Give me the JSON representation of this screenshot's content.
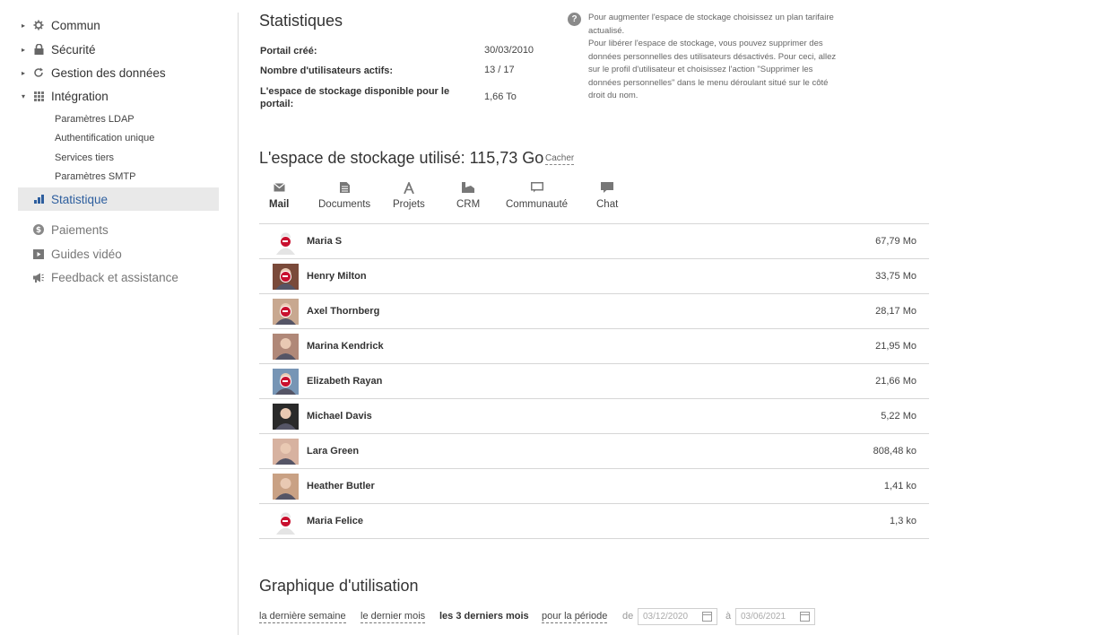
{
  "sidebar": {
    "items": [
      {
        "label": "Commun",
        "icon": "gear-icon",
        "arrow": "right"
      },
      {
        "label": "Sécurité",
        "icon": "lock-icon",
        "arrow": "right"
      },
      {
        "label": "Gestion des données",
        "icon": "refresh-icon",
        "arrow": "right"
      },
      {
        "label": "Intégration",
        "icon": "grid-icon",
        "arrow": "down"
      }
    ],
    "subitems": [
      "Paramètres LDAP",
      "Authentification unique",
      "Services tiers",
      "Paramètres SMTP"
    ],
    "active": {
      "label": "Statistique",
      "icon": "bar-chart-icon"
    },
    "bottom": [
      {
        "label": "Paiements",
        "icon": "dollar-icon"
      },
      {
        "label": "Guides vidéo",
        "icon": "video-icon"
      },
      {
        "label": "Feedback et assistance",
        "icon": "megaphone-icon"
      }
    ]
  },
  "stats": {
    "title": "Statistiques",
    "rows": [
      {
        "label": "Portail créé:",
        "value": "30/03/2010"
      },
      {
        "label": "Nombre d'utilisateurs actifs:",
        "value": "13 / 17"
      },
      {
        "label": "L'espace de stockage disponible pour le portail:",
        "value": "1,66 To"
      }
    ],
    "help_icon": "question-icon",
    "help_lines": [
      "Pour augmenter l'espace de stockage choisissez un plan tarifaire actualisé.",
      "Pour libérer l'espace de stockage, vous pouvez supprimer des données personnelles des utilisateurs désactivés. Pour ceci, allez sur le profil d'utilisateur et choisissez l'action \"Supprimer les données personnelles\" dans le menu déroulant situé sur le côté droit du nom."
    ]
  },
  "storage": {
    "title": "L'espace de stockage utilisé: 115,73 Go",
    "hide_label": "Cacher",
    "tabs": [
      {
        "label": "Mail",
        "icon": "mail-icon",
        "active": true
      },
      {
        "label": "Documents",
        "icon": "document-icon",
        "active": false
      },
      {
        "label": "Projets",
        "icon": "projects-icon",
        "active": false
      },
      {
        "label": "CRM",
        "icon": "crm-icon",
        "active": false
      },
      {
        "label": "Communauté",
        "icon": "community-icon",
        "active": false
      },
      {
        "label": "Chat",
        "icon": "chat-icon",
        "active": false
      }
    ],
    "users": [
      {
        "name": "Maria S",
        "size": "67,79 Mo",
        "blocked": true,
        "avatar": "default"
      },
      {
        "name": "Henry Milton",
        "size": "33,75 Mo",
        "blocked": true,
        "avatar": "photo"
      },
      {
        "name": "Axel Thornberg",
        "size": "28,17 Mo",
        "blocked": true,
        "avatar": "photo"
      },
      {
        "name": "Marina Kendrick",
        "size": "21,95 Mo",
        "blocked": false,
        "avatar": "photo"
      },
      {
        "name": "Elizabeth Rayan",
        "size": "21,66 Mo",
        "blocked": true,
        "avatar": "photo"
      },
      {
        "name": "Michael Davis",
        "size": "5,22 Mo",
        "blocked": false,
        "avatar": "photo"
      },
      {
        "name": "Lara Green",
        "size": "808,48 ko",
        "blocked": false,
        "avatar": "photo"
      },
      {
        "name": "Heather Butler",
        "size": "1,41 ko",
        "blocked": false,
        "avatar": "photo"
      },
      {
        "name": "Maria Felice",
        "size": "1,3 ko",
        "blocked": true,
        "avatar": "default"
      }
    ]
  },
  "usage": {
    "title": "Graphique d'utilisation",
    "periods": [
      "la dernière semaine",
      "le dernier mois",
      "les 3 derniers mois",
      "pour la période"
    ],
    "selected_period": "les 3 derniers mois",
    "from_label": "de",
    "to_label": "à",
    "from_date": "03/12/2020",
    "to_date": "03/06/2021"
  },
  "colors": {
    "accent": "#2d5e9e",
    "blocked": "#c8102e",
    "divider": "#d6d6d6"
  }
}
